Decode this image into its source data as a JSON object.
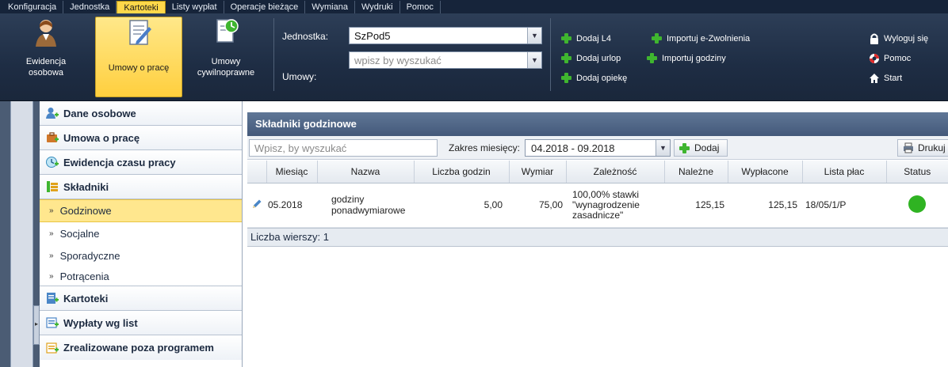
{
  "menu": {
    "tabs": [
      {
        "label": "Konfiguracja",
        "active": false
      },
      {
        "label": "Jednostka",
        "active": false
      },
      {
        "label": "Kartoteki",
        "active": true
      },
      {
        "label": "Listy wypłat",
        "active": false
      },
      {
        "label": "Operacje bieżące",
        "active": false
      },
      {
        "label": "Wymiana",
        "active": false
      },
      {
        "label": "Wydruki",
        "active": false
      },
      {
        "label": "Pomoc",
        "active": false
      }
    ]
  },
  "ribbon": {
    "buttons": {
      "ewidencja_line1": "Ewidencja",
      "ewidencja_line2": "osobowa",
      "umowy_prace": "Umowy o pracę",
      "umowy_cyw_line1": "Umowy",
      "umowy_cyw_line2": "cywilnoprawne"
    },
    "jednostka_label": "Jednostka:",
    "jednostka_value": "SzPod5",
    "umowy_label": "Umowy:",
    "umowy_placeholder": "wpisz by wyszukać",
    "actions": {
      "dodaj_l4": "Dodaj L4",
      "dodaj_urlop": "Dodaj urlop",
      "dodaj_opieke": "Dodaj opiekę",
      "import_zwolnienia": "Importuj e-Zwolnienia",
      "import_godziny": "Importuj godziny"
    },
    "right": {
      "logout": "Wyloguj się",
      "help": "Pomoc",
      "start": "Start"
    }
  },
  "nav": {
    "dane_osobowe": "Dane osobowe",
    "umowa_o_prace": "Umowa o pracę",
    "ewidencja_czasu": "Ewidencja czasu pracy",
    "skladniki": "Składniki",
    "sub": {
      "godzinowe": "Godzinowe",
      "socjalne": "Socjalne",
      "sporadyczne": "Sporadyczne",
      "potracenia": "Potrącenia"
    },
    "kartoteki": "Kartoteki",
    "wyplaty": "Wypłaty wg list",
    "zrealizowane": "Zrealizowane poza programem"
  },
  "panel": {
    "title": "Składniki godzinowe",
    "search_placeholder": "Wpisz, by wyszukać",
    "range_label": "Zakres miesięcy:",
    "range_value": "04.2018 - 09.2018",
    "add_label": "Dodaj",
    "print_label": "Drukuj"
  },
  "table": {
    "headers": {
      "miesiac": "Miesiąc",
      "nazwa": "Nazwa",
      "liczba_godzin": "Liczba godzin",
      "wymiar": "Wymiar",
      "zaleznosc": "Zależność",
      "nalezne": "Należne",
      "wyplacone": "Wypłacone",
      "lista_plac": "Lista płac",
      "status": "Status"
    },
    "rows": [
      {
        "miesiac": "05.2018",
        "nazwa_line1": "godziny",
        "nazwa_line2": "ponadwymiarowe",
        "liczba_godzin": "5,00",
        "wymiar": "75,00",
        "zaleznosc_line1": "100,00% stawki",
        "zaleznosc_line2": "\"wynagrodzenie",
        "zaleznosc_line3": "zasadnicze\"",
        "nalezne": "125,15",
        "wyplacone": "125,15",
        "lista_plac": "18/05/1/P",
        "status_color": "#2fb322"
      }
    ]
  },
  "footer": {
    "row_count": "Liczba wierszy: 1"
  }
}
